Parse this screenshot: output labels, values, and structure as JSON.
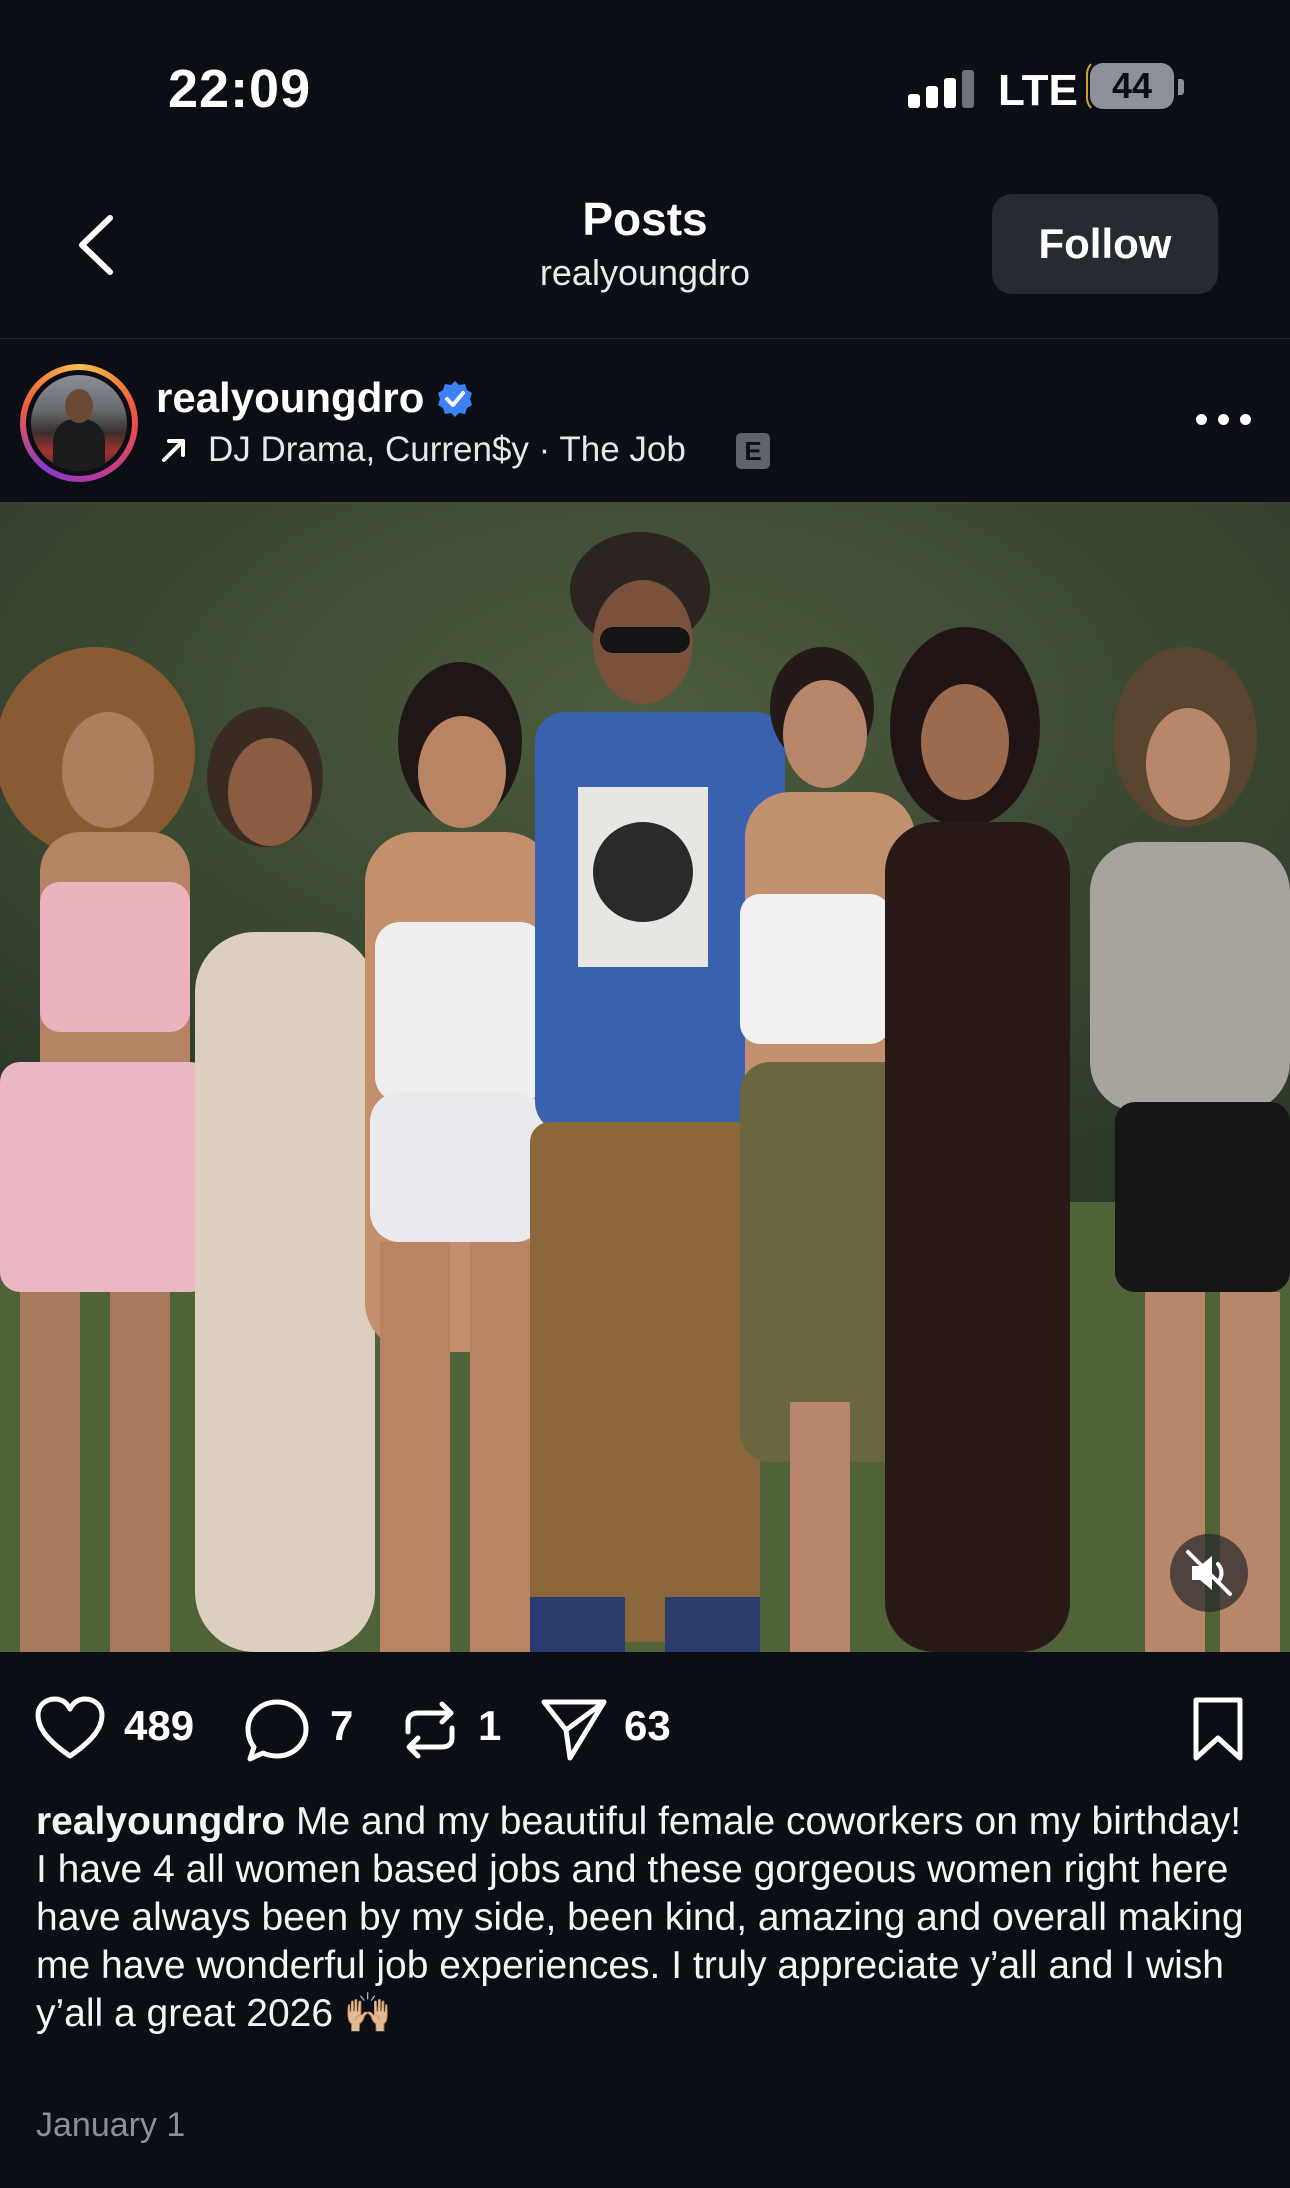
{
  "status_bar": {
    "time": "22:09",
    "network": "LTE",
    "battery": "44"
  },
  "header": {
    "title": "Posts",
    "subtitle": "realyoungdro",
    "follow_label": "Follow"
  },
  "post": {
    "username": "realyoungdro",
    "music": "DJ Drama, Curren$y · The Job",
    "explicit": "E",
    "likes": "489",
    "comments": "7",
    "reposts": "1",
    "shares": "63",
    "caption_user": "realyoungdro",
    "caption_text": "Me and my beautiful female coworkers on my birthday! I have 4 all women based jobs and these gorgeous women right here have always been by my side, been kind, amazing and overall making me have wonderful job experiences. I truly appreciate y’all and I wish y’all a great 2026 🙌🏼",
    "date": "January 1"
  },
  "colors": {
    "background": "#0b0e14",
    "verified": "#3b82f6",
    "follow_bg": "#262a31"
  },
  "icons": [
    "back-chevron-icon",
    "verified-icon",
    "arrow-up-right-icon",
    "more-icon",
    "muted-speaker-icon",
    "heart-icon",
    "comment-icon",
    "repost-icon",
    "share-icon",
    "bookmark-icon"
  ]
}
